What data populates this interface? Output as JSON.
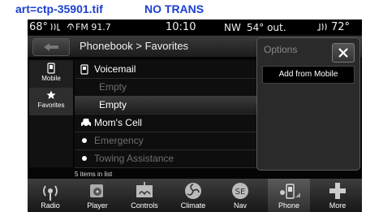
{
  "header": {
    "file_tag": "art=ctp-35901.tif",
    "note": "NO TRANS"
  },
  "status_bar": {
    "temp_left": "68°",
    "radio": "FM 91.7",
    "time": "10:10",
    "heading": "NW",
    "outside": "54° out.",
    "temp_right": "72°"
  },
  "breadcrumb": "Phonebook > Favorites",
  "sidebar": [
    {
      "label": "Mobile",
      "icon": "mobile-icon"
    },
    {
      "label": "Favorites",
      "icon": "star-icon"
    }
  ],
  "list": [
    {
      "label": "Voicemail",
      "state": "normal",
      "icon": "voicemail-icon"
    },
    {
      "label": "Empty",
      "state": "dim",
      "icon": ""
    },
    {
      "label": "Empty",
      "state": "selected",
      "icon": ""
    },
    {
      "label": "Mom's Cell",
      "state": "normal",
      "icon": "vehicle-icon"
    },
    {
      "label": "Emergency",
      "state": "dim",
      "icon": "dot-icon"
    },
    {
      "label": "Towing Assistance",
      "state": "dim",
      "icon": "dot-icon"
    }
  ],
  "list_count": "5 items in list",
  "options": {
    "title": "Options",
    "add_from_mobile": "Add from Mobile"
  },
  "bottom_nav": [
    {
      "label": "Radio",
      "icon": "radio-icon"
    },
    {
      "label": "Player",
      "icon": "player-icon"
    },
    {
      "label": "Controls",
      "icon": "controls-icon"
    },
    {
      "label": "Climate",
      "icon": "climate-icon"
    },
    {
      "label": "Nav",
      "icon": "compass-icon"
    },
    {
      "label": "Phone",
      "icon": "phone-icon",
      "active": true
    },
    {
      "label": "More",
      "icon": "plus-icon"
    }
  ]
}
